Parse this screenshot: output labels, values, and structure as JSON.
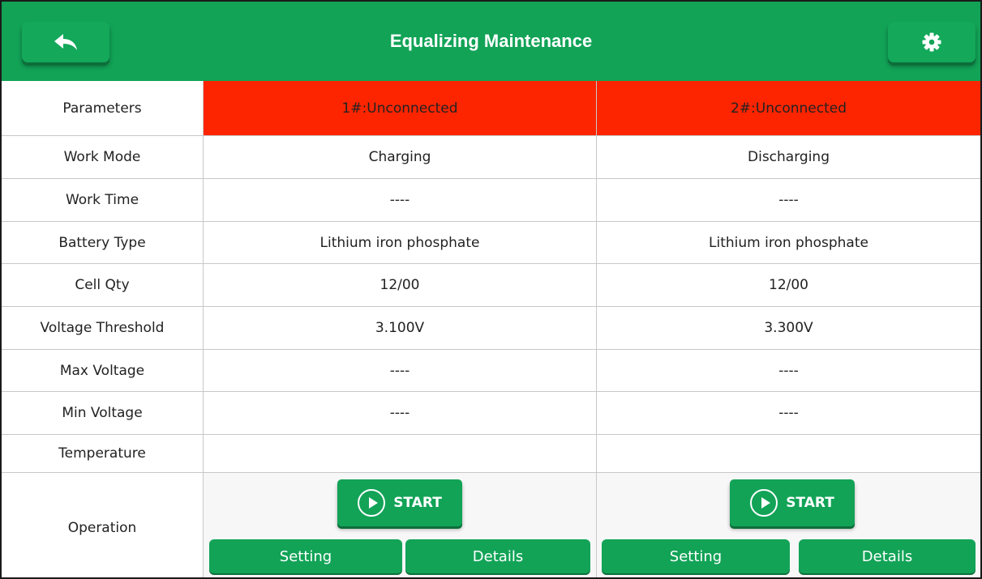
{
  "header": {
    "title": "Equalizing Maintenance",
    "back_icon": "back-arrow-icon",
    "settings_icon": "gear-icon"
  },
  "colors": {
    "header": "#12a357",
    "button": "#12a357",
    "status_unconnected": "#fd2500"
  },
  "table": {
    "parameters_label": "Parameters",
    "channels": [
      {
        "status": "1#:Unconnected"
      },
      {
        "status": "2#:Unconnected"
      }
    ],
    "rows": [
      {
        "label": "Work Mode",
        "values": [
          "Charging",
          "Discharging"
        ]
      },
      {
        "label": "Work Time",
        "values": [
          "----",
          "----"
        ]
      },
      {
        "label": "Battery Type",
        "values": [
          "Lithium iron phosphate",
          "Lithium iron phosphate"
        ]
      },
      {
        "label": "Cell Qty",
        "values": [
          "12/00",
          "12/00"
        ]
      },
      {
        "label": "Voltage Threshold",
        "values": [
          "3.100V",
          "3.300V"
        ]
      },
      {
        "label": "Max Voltage",
        "values": [
          "----",
          "----"
        ]
      },
      {
        "label": "Min Voltage",
        "values": [
          "----",
          "----"
        ]
      },
      {
        "label": "Temperature",
        "values": [
          "",
          ""
        ]
      }
    ],
    "operation_label": "Operation",
    "start_label": "START",
    "setting_label": "Setting",
    "details_label": "Details"
  }
}
